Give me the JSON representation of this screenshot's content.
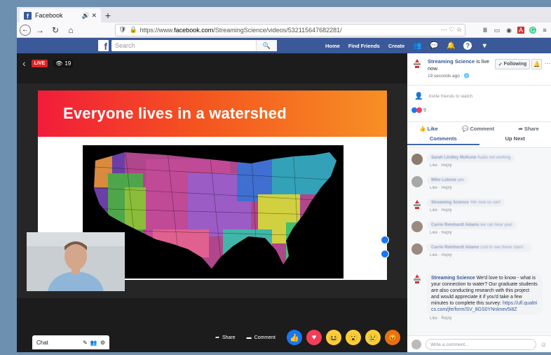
{
  "browser": {
    "tab_title": "Facebook",
    "tab_icons": "🔊 ✕",
    "new_tab": "+",
    "url_domain_prefix": "https://www.",
    "url_domain": "facebook.com",
    "url_path": "/StreamingScience/videos/532115647682281/",
    "url_right_icons": "··· ♡ ☆"
  },
  "fb_header": {
    "logo": "f",
    "search_placeholder": "Search",
    "nav_home": "Home",
    "nav_find_friends": "Find Friends",
    "nav_create": "Create"
  },
  "player": {
    "live_label": "LIVE",
    "viewer_count": "19",
    "slide_title": "Everyone lives in a watershed",
    "share_label": "Share",
    "comment_label": "Comment",
    "chat_label": "Chat"
  },
  "panel": {
    "page_name": "Streaming Science",
    "status_text": " is live now.",
    "time_ago": "19 seconds ago · ",
    "following_label": "Following",
    "invite_text": "Invite friends to watch",
    "reaction_count": "9",
    "like_label": "Like",
    "comment_label": "Comment",
    "share_label": "Share",
    "tab_comments": "Comments",
    "tab_up_next": "Up Next",
    "write_placeholder": "Write a comment...",
    "comments": [
      {
        "name": "Sarah Lindley McKune",
        "text": "Audio not working",
        "meta": "Like · Reply"
      },
      {
        "name": "Mike Lukose",
        "text": "yes",
        "meta": "Like · Reply"
      },
      {
        "name": "Streaming Science",
        "text": "Yeh now so can!",
        "meta": "Like · Reply"
      },
      {
        "name": "Carrie Reinhardt Adams",
        "text": "we can hear you!",
        "meta": "Like · Reply"
      },
      {
        "name": "Carrie Reinhardt Adams",
        "text": "cool to see these stars!",
        "meta": "Like · Reply"
      }
    ],
    "featured_comment": {
      "name": "Streaming Science",
      "text": " We'd love to know - what is your connection to water? Our graduate students are also conducting research with this project and would appreciate it if you'd take a few minutes to complete this survey: ",
      "link": "https://ufl.qualtrics.com/jfe/form/SV_8GS0YNnlmev5i8Z",
      "meta": "Like · Reply"
    }
  },
  "colors": {
    "fb_blue": "#3b5998",
    "live_red": "#e02222",
    "banner_start": "#f21c3a",
    "banner_end": "#f79024"
  }
}
